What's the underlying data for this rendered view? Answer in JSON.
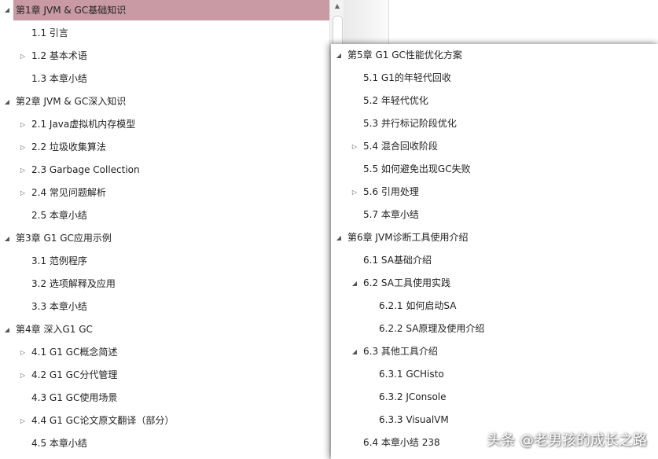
{
  "left_tree": [
    {
      "label": "第1章 JVM & GC基础知识",
      "arrow": "◢",
      "selected": true
    },
    {
      "label": "1.1 引言",
      "arrow": ""
    },
    {
      "label": "1.2 基本术语",
      "arrow": "▷"
    },
    {
      "label": "1.3 本章小结",
      "arrow": ""
    },
    {
      "label": "第2章 JVM & GC深入知识",
      "arrow": "◢"
    },
    {
      "label": "2.1 Java虚拟机内存模型",
      "arrow": "▷"
    },
    {
      "label": "2.2 垃圾收集算法",
      "arrow": "▷"
    },
    {
      "label": "2.3 Garbage Collection",
      "arrow": "▷"
    },
    {
      "label": "2.4 常见问题解析",
      "arrow": "▷"
    },
    {
      "label": "2.5 本章小结",
      "arrow": ""
    },
    {
      "label": "第3章 G1 GC应用示例",
      "arrow": "◢"
    },
    {
      "label": "3.1 范例程序",
      "arrow": ""
    },
    {
      "label": "3.2 选项解释及应用",
      "arrow": ""
    },
    {
      "label": "3.3 本章小结",
      "arrow": ""
    },
    {
      "label": "第4章 深入G1 GC",
      "arrow": "◢"
    },
    {
      "label": "4.1 G1 GC概念简述",
      "arrow": "▷"
    },
    {
      "label": "4.2 G1 GC分代管理",
      "arrow": "▷"
    },
    {
      "label": "4.3 G1 GC使用场景",
      "arrow": ""
    },
    {
      "label": "4.4 G1 GC论文原文翻译（部分）",
      "arrow": "▷"
    },
    {
      "label": "4.5 本章小结",
      "arrow": ""
    }
  ],
  "right_tree": [
    {
      "label": "第5章 G1 GC性能优化方案",
      "arrow": "◢"
    },
    {
      "label": "5.1 G1的年轻代回收",
      "arrow": ""
    },
    {
      "label": "5.2 年轻代优化",
      "arrow": ""
    },
    {
      "label": "5.3 并行标记阶段优化",
      "arrow": ""
    },
    {
      "label": "5.4 混合回收阶段",
      "arrow": "▷"
    },
    {
      "label": "5.5 如何避免出现GC失败",
      "arrow": ""
    },
    {
      "label": "5.6 引用处理",
      "arrow": "▷"
    },
    {
      "label": "5.7 本章小结",
      "arrow": ""
    },
    {
      "label": "第6章 JVM诊断工具使用介绍",
      "arrow": "◢"
    },
    {
      "label": "6.1 SA基础介绍",
      "arrow": ""
    },
    {
      "label": "6.2 SA工具使用实践",
      "arrow": "◢"
    },
    {
      "label": "6.2.1 如何启动SA",
      "arrow": ""
    },
    {
      "label": "6.2.2 SA原理及使用介绍",
      "arrow": ""
    },
    {
      "label": "6.3 其他工具介绍",
      "arrow": "◢"
    },
    {
      "label": "6.3.1 GCHisto",
      "arrow": ""
    },
    {
      "label": "6.3.2 JConsole",
      "arrow": ""
    },
    {
      "label": "6.3.3 VisualVM",
      "arrow": ""
    },
    {
      "label": "6.4 本章小结 238",
      "arrow": ""
    }
  ],
  "scrollbar": {
    "up_glyph": "▲"
  },
  "watermark": "头条 @老男孩的成长之路",
  "colors": {
    "selection": "#c99aa3"
  }
}
